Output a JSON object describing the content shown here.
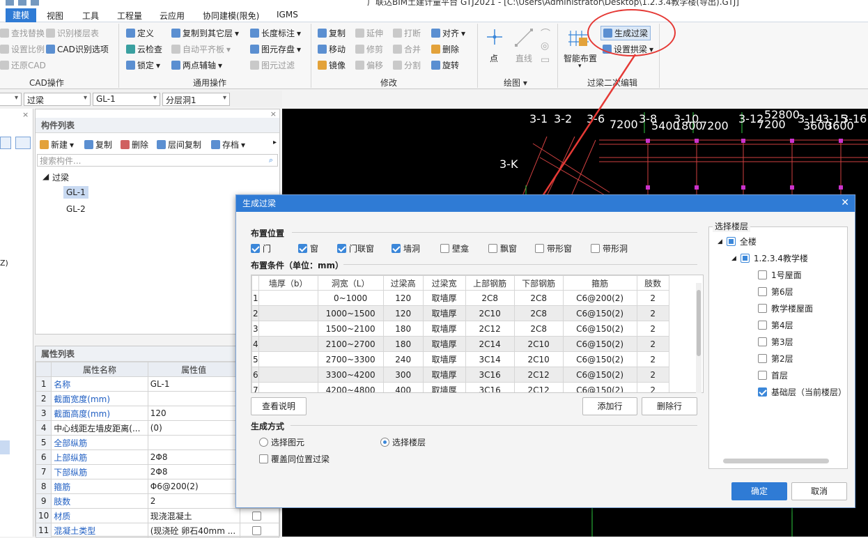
{
  "title_bar": {
    "text": "广联达BIM土建计量平台 GTJ2021 - [C:\\Users\\Administrator\\Desktop\\1.2.3.4教学楼(导出).GTJ]"
  },
  "menu": [
    "建模",
    "视图",
    "工具",
    "工程量",
    "云应用",
    "协同建模(限免)",
    "IGMS"
  ],
  "ribbon": {
    "cad": {
      "find_replace": "查找替换",
      "identify_floor": "识别楼层表",
      "set_scale": "设置比例",
      "cad_options": "CAD识别选项",
      "restore_cad": "还原CAD",
      "group": "CAD操作"
    },
    "general": {
      "define": "定义",
      "copy_to_floor": "复制到其它层",
      "length_mark": "长度标注",
      "cloud_check": "云检查",
      "auto_level": "自动平齐板",
      "save_elem": "图元存盘",
      "lock": "锁定",
      "two_point_axis": "两点辅轴",
      "elem_filter": "图元过滤",
      "group": "通用操作"
    },
    "modify": {
      "copy": "复制",
      "extend": "延伸",
      "break": "打断",
      "align": "对齐",
      "move": "移动",
      "trim": "修剪",
      "merge": "合并",
      "delete": "删除",
      "mirror": "镜像",
      "offset": "偏移",
      "split": "分割",
      "rotate": "旋转",
      "group": "修改"
    },
    "draw": {
      "point": "点",
      "line": "直线",
      "group": "绘图"
    },
    "lintel_edit": {
      "smart_layout": "智能布置",
      "gen_lintel": "生成过梁",
      "set_arch": "设置拱梁",
      "group": "过梁二次编辑"
    }
  },
  "toolrow": {
    "type": "过梁",
    "name": "GL-1",
    "layer": "分层洞1"
  },
  "component_list": {
    "title": "构件列表",
    "new": "新建",
    "copy": "复制",
    "delete": "删除",
    "floor_copy": "层间复制",
    "archive": "存档",
    "search_placeholder": "搜索构件...",
    "root": "过梁",
    "items": [
      "GL-1",
      "GL-2"
    ]
  },
  "property_list": {
    "title": "属性列表",
    "col_name": "属性名称",
    "col_value": "属性值",
    "rows": [
      {
        "n": "1",
        "name": "名称",
        "value": "GL-1"
      },
      {
        "n": "2",
        "name": "截面宽度(mm)",
        "value": ""
      },
      {
        "n": "3",
        "name": "截面高度(mm)",
        "value": "120"
      },
      {
        "n": "4",
        "name": "中心线距左墙皮距离(...",
        "value": "(0)"
      },
      {
        "n": "5",
        "name": "全部纵筋",
        "value": ""
      },
      {
        "n": "6",
        "name": "上部纵筋",
        "value": "2Φ8"
      },
      {
        "n": "7",
        "name": "下部纵筋",
        "value": "2Φ8"
      },
      {
        "n": "8",
        "name": "箍筋",
        "value": "Φ6@200(2)"
      },
      {
        "n": "9",
        "name": "肢数",
        "value": "2"
      },
      {
        "n": "10",
        "name": "材质",
        "value": "现浇混凝土"
      },
      {
        "n": "11",
        "name": "混凝土类型",
        "value": "(现浇砼 卵石40mm ..."
      }
    ]
  },
  "cad_labels": [
    "3-1",
    "3-2",
    "3-6",
    "3-8",
    "3-10",
    "3-12",
    "3-14",
    "3-15",
    "3-16",
    "3-K",
    "7200",
    "5400",
    "1800",
    "7200",
    "7200",
    "3600",
    "3600",
    "52800"
  ],
  "dialog": {
    "title": "生成过梁",
    "position_section": "布置位置",
    "positions": [
      {
        "label": "门",
        "checked": true
      },
      {
        "label": "窗",
        "checked": true
      },
      {
        "label": "门联窗",
        "checked": true
      },
      {
        "label": "墙洞",
        "checked": true
      },
      {
        "label": "壁龛",
        "checked": false
      },
      {
        "label": "飘窗",
        "checked": false
      },
      {
        "label": "带形窗",
        "checked": false
      },
      {
        "label": "带形洞",
        "checked": false
      }
    ],
    "condition_section": "布置条件（单位：mm）",
    "columns": [
      "墙厚（b）",
      "洞宽（L）",
      "过梁高",
      "过梁宽",
      "上部钢筋",
      "下部钢筋",
      "箍筋",
      "肢数"
    ],
    "rows": [
      [
        "1",
        "",
        "0~1000",
        "120",
        "取墙厚",
        "2C8",
        "2C8",
        "C6@200(2)",
        "2"
      ],
      [
        "2",
        "",
        "1000~1500",
        "120",
        "取墙厚",
        "2C10",
        "2C8",
        "C6@150(2)",
        "2"
      ],
      [
        "3",
        "",
        "1500~2100",
        "180",
        "取墙厚",
        "2C12",
        "2C8",
        "C6@150(2)",
        "2"
      ],
      [
        "4",
        "",
        "2100~2700",
        "180",
        "取墙厚",
        "2C14",
        "2C10",
        "C6@150(2)",
        "2"
      ],
      [
        "5",
        "",
        "2700~3300",
        "240",
        "取墙厚",
        "3C14",
        "2C10",
        "C6@150(2)",
        "2"
      ],
      [
        "6",
        "",
        "3300~4200",
        "300",
        "取墙厚",
        "3C16",
        "2C12",
        "C6@150(2)",
        "2"
      ],
      [
        "7",
        "",
        "4200~4800",
        "400",
        "取墙厚",
        "3C16",
        "2C12",
        "C6@150(2)",
        "2"
      ]
    ],
    "view_desc": "查看说明",
    "add_row": "添加行",
    "delete_row": "删除行",
    "method_section": "生成方式",
    "method_elem": "选择图元",
    "method_floor": "选择楼层",
    "method_selected": "选择楼层",
    "overwrite": "覆盖同位置过梁",
    "floor_section": "选择楼层",
    "floor_root": "全楼",
    "building": "1.2.3.4教学楼",
    "floors": [
      {
        "label": "1号屋面",
        "checked": false
      },
      {
        "label": "第6层",
        "checked": false
      },
      {
        "label": "教学楼屋面",
        "checked": false
      },
      {
        "label": "第4层",
        "checked": false
      },
      {
        "label": "第3层",
        "checked": false
      },
      {
        "label": "第2层",
        "checked": false
      },
      {
        "label": "首层",
        "checked": false
      },
      {
        "label": "基础层（当前楼层）",
        "checked": true
      }
    ],
    "ok": "确定",
    "cancel": "取消"
  },
  "colors": {
    "accent": "#2f7bd5",
    "annotation": "#e53935",
    "cad_bg": "#000000",
    "cad_line": "#d04040",
    "cad_text": "#ffffff"
  }
}
